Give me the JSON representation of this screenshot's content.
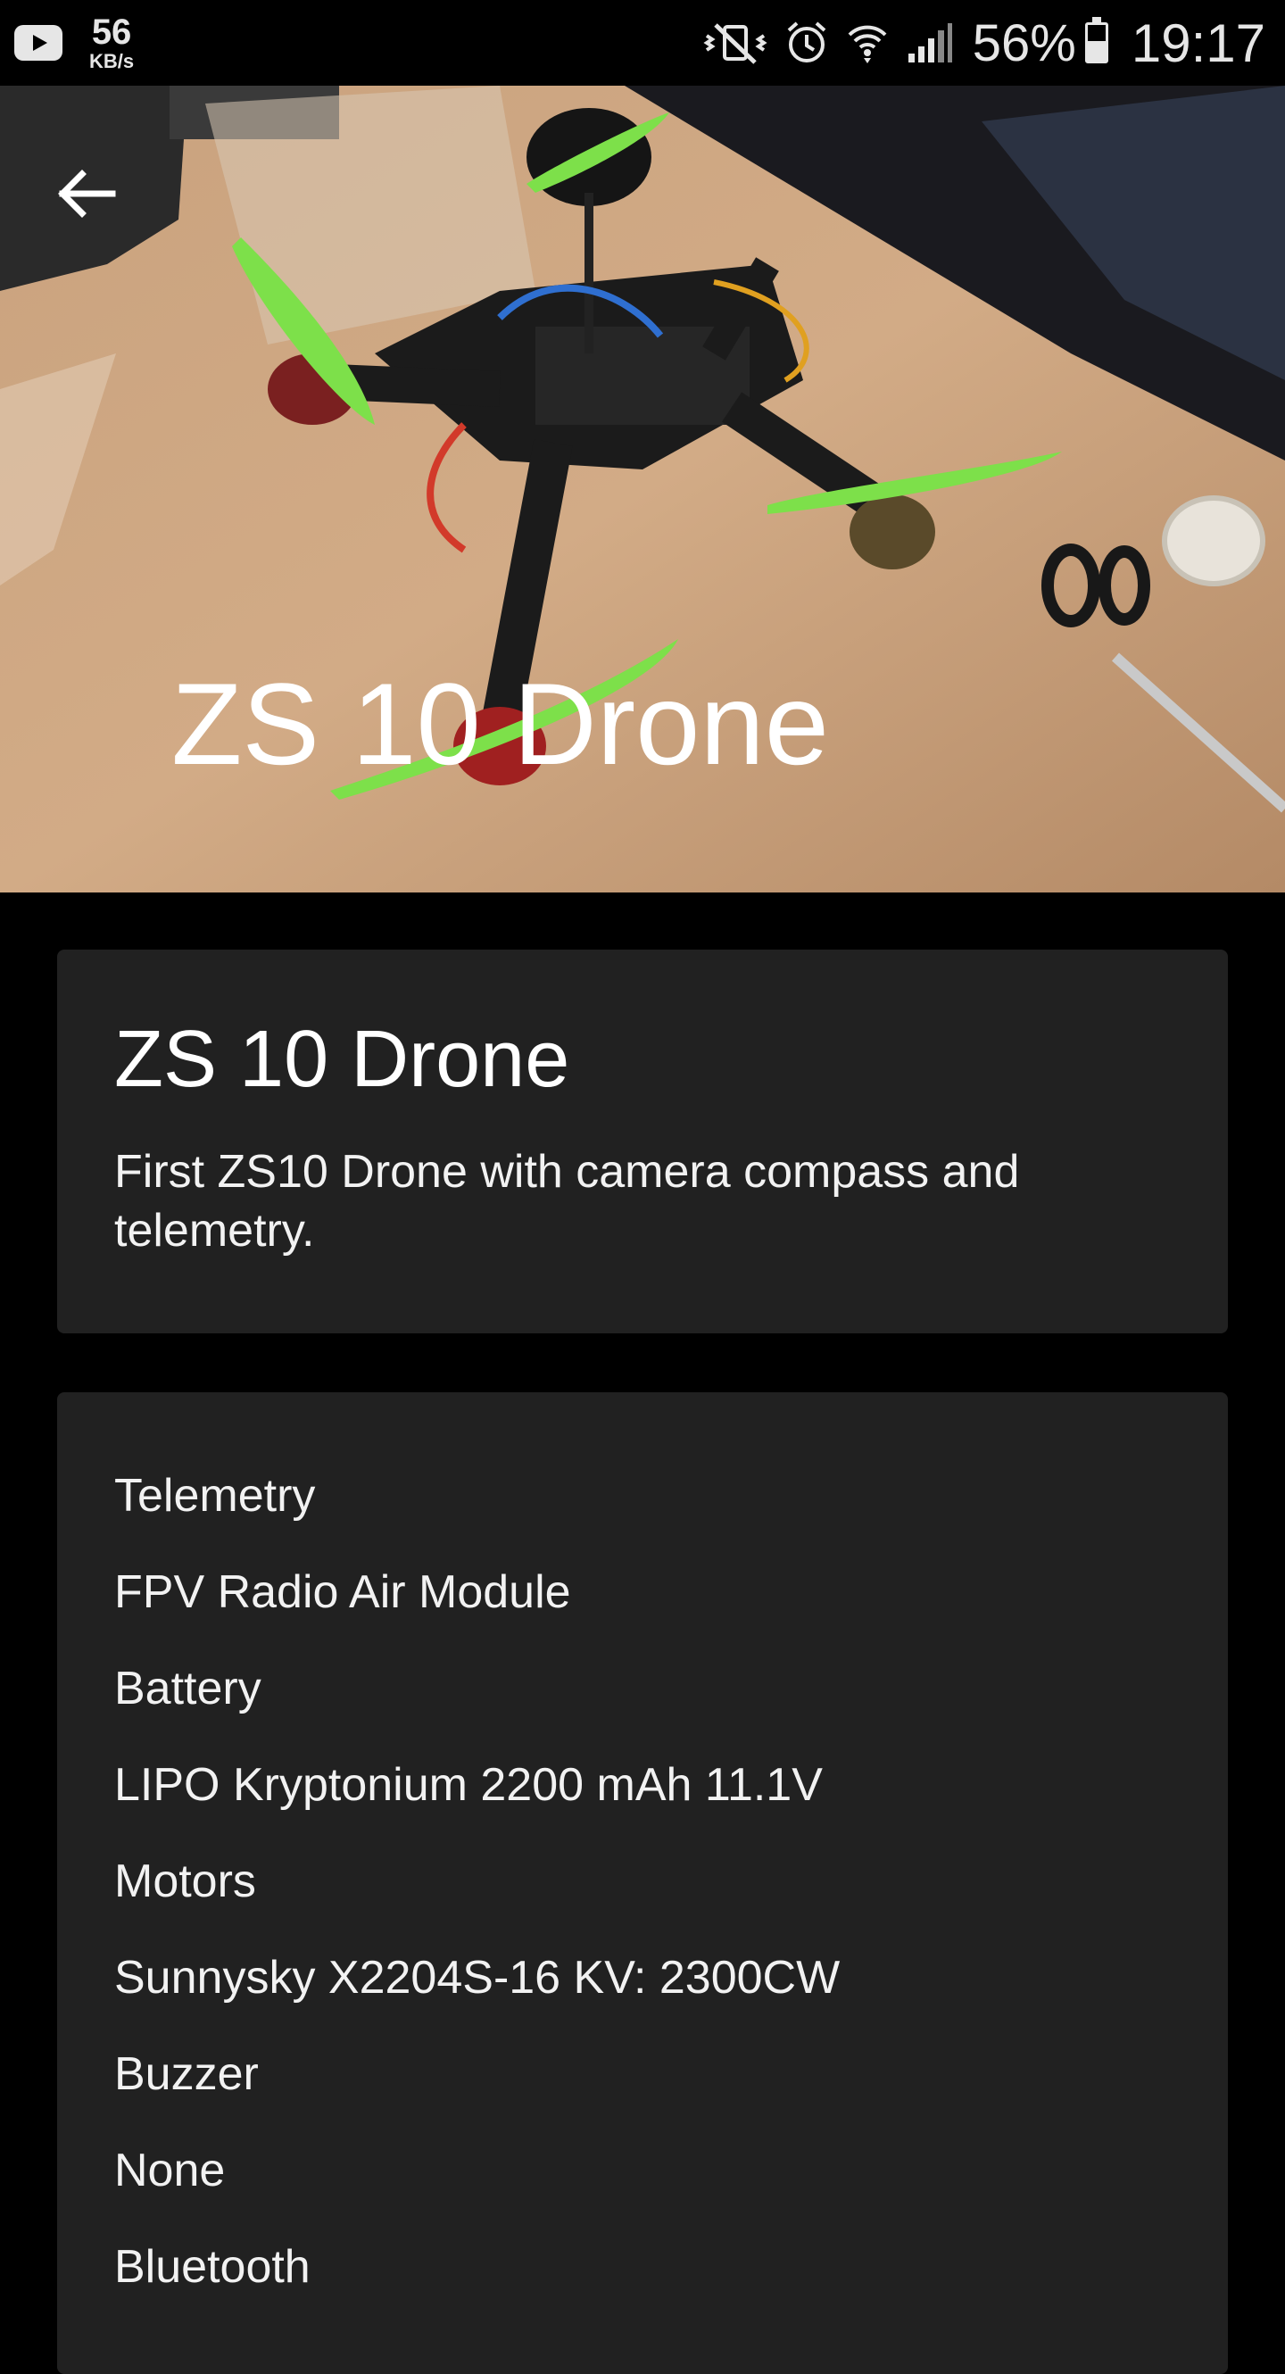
{
  "status_bar": {
    "net_speed_value": "56",
    "net_speed_unit": "KB/s",
    "battery_percent": "56%",
    "battery_level": 0.56,
    "time": "19:17",
    "icons": [
      "youtube-icon",
      "vibrate-mute-icon",
      "alarm-icon",
      "wifi-icon",
      "cell-signal-icon",
      "battery-icon"
    ]
  },
  "header": {
    "title": "ZS 10 Drone",
    "back_icon": "arrow-left-icon",
    "image_subject": "quadcopter drone on a wooden table"
  },
  "intro_card": {
    "title": "ZS 10 Drone",
    "description": "First ZS10 Drone with camera compass and telemetry."
  },
  "specs": [
    "Telemetry",
    "FPV Radio Air Module",
    "Battery",
    "LIPO Kryptonium 2200 mAh 11.1V",
    "Motors",
    "Sunnysky X2204S-16 KV: 2300CW",
    "Buzzer",
    "None",
    "Bluetooth"
  ],
  "colors": {
    "background": "#000000",
    "card": "#212121",
    "text": "#ffffff",
    "propeller": "#7de04a"
  }
}
